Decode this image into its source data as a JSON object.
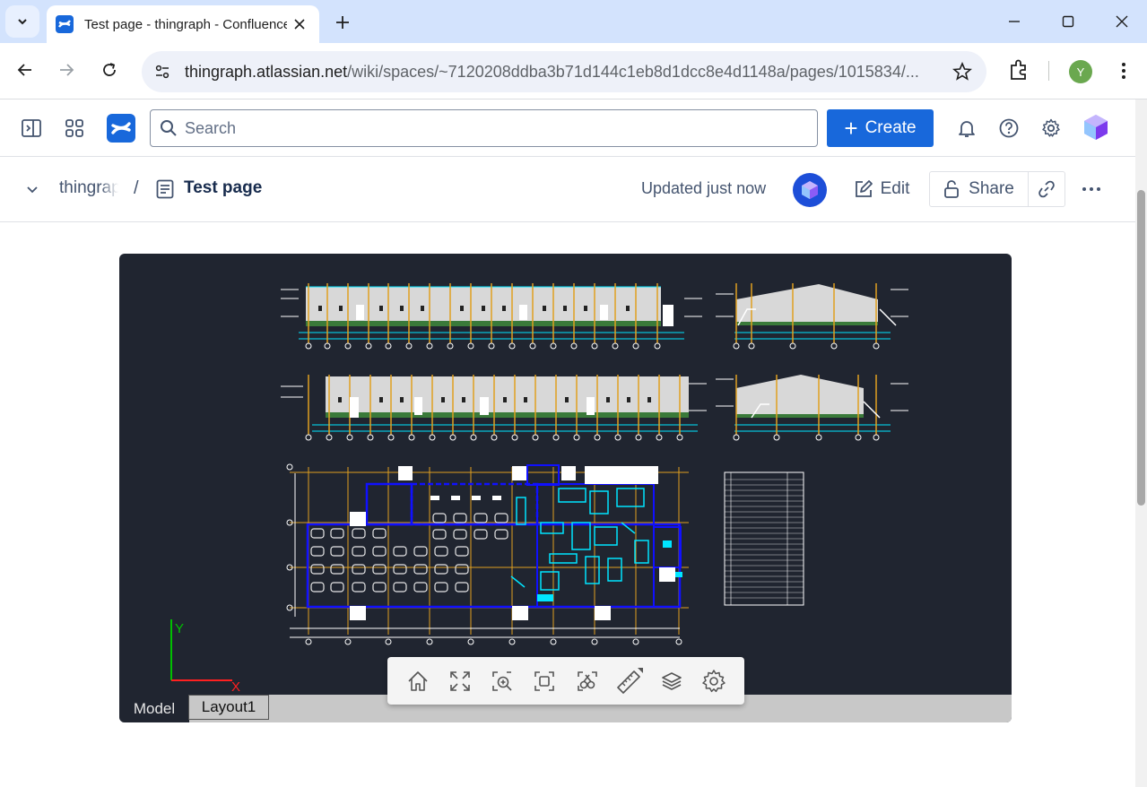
{
  "browser": {
    "tab_title": "Test page - thingraph - Confluence",
    "url_host": "thingraph.atlassian.net",
    "url_path": "/wiki/spaces/~7120208ddba3b71d144c1eb8d1dcc8e4d1148a/pages/1015834/...",
    "profile_initial": "Y"
  },
  "confluence": {
    "search_placeholder": "Search",
    "create_label": "Create"
  },
  "page": {
    "space_crumb": "thingraph",
    "separator": "/",
    "title": "Test page",
    "updated": "Updated just now",
    "edit_label": "Edit",
    "share_label": "Share"
  },
  "viewer": {
    "tabs": [
      "Model",
      "Layout1"
    ],
    "axis_y": "Y",
    "axis_x": "X",
    "tools": [
      "home-icon",
      "fit-extents-icon",
      "zoom-window-icon",
      "zoom-region-icon",
      "compare-icon",
      "measure-icon",
      "layers-icon",
      "settings-icon"
    ]
  },
  "colors": {
    "accent": "#1868db",
    "viewer_bg": "#202530",
    "cad_blue": "#1010ff",
    "cad_cyan": "#00e5ff",
    "cad_orange": "#e0a020",
    "axis_green": "#00c000",
    "axis_red": "#ff2020"
  }
}
